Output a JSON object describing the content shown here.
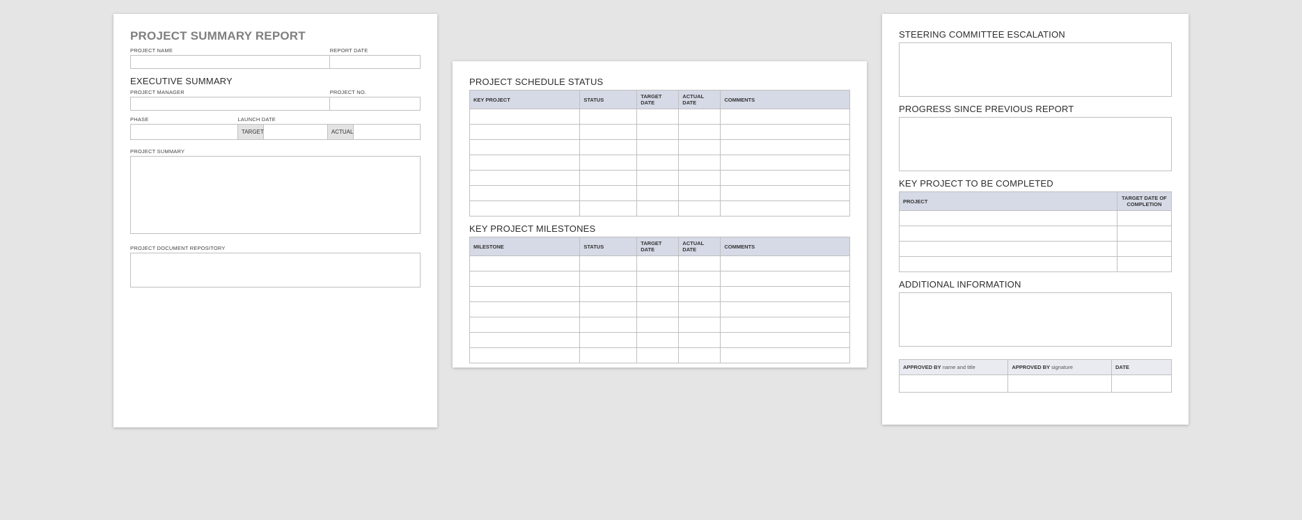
{
  "page1": {
    "title": "PROJECT SUMMARY REPORT",
    "project_name_label": "PROJECT NAME",
    "report_date_label": "REPORT DATE",
    "exec_summary_title": "EXECUTIVE SUMMARY",
    "project_manager_label": "PROJECT MANAGER",
    "project_no_label": "PROJECT NO.",
    "phase_label": "PHASE",
    "launch_date_label": "LAUNCH DATE",
    "target_label": "TARGET",
    "actual_label": "ACTUAL",
    "project_summary_label": "PROJECT SUMMARY",
    "repo_label": "PROJECT DOCUMENT REPOSITORY"
  },
  "page2": {
    "schedule_title": "PROJECT SCHEDULE STATUS",
    "schedule_headers": [
      "KEY PROJECT",
      "STATUS",
      "TARGET DATE",
      "ACTUAL DATE",
      "COMMENTS"
    ],
    "schedule_rows": 7,
    "milestones_title": "KEY PROJECT MILESTONES",
    "milestones_headers": [
      "MILESTONE",
      "STATUS",
      "TARGET DATE",
      "ACTUAL DATE",
      "COMMENTS"
    ],
    "milestones_rows": 7
  },
  "page3": {
    "steering_title": "STEERING COMMITTEE ESCALATION",
    "progress_title": "PROGRESS SINCE PREVIOUS REPORT",
    "key_project_title": "KEY PROJECT TO BE COMPLETED",
    "key_headers": [
      "PROJECT",
      "TARGET DATE OF COMPLETION"
    ],
    "key_rows": 4,
    "additional_title": "ADDITIONAL INFORMATION",
    "approved_by_label": "APPROVED BY",
    "name_title_label": "name and title",
    "signature_label": "signature",
    "date_label": "DATE"
  }
}
